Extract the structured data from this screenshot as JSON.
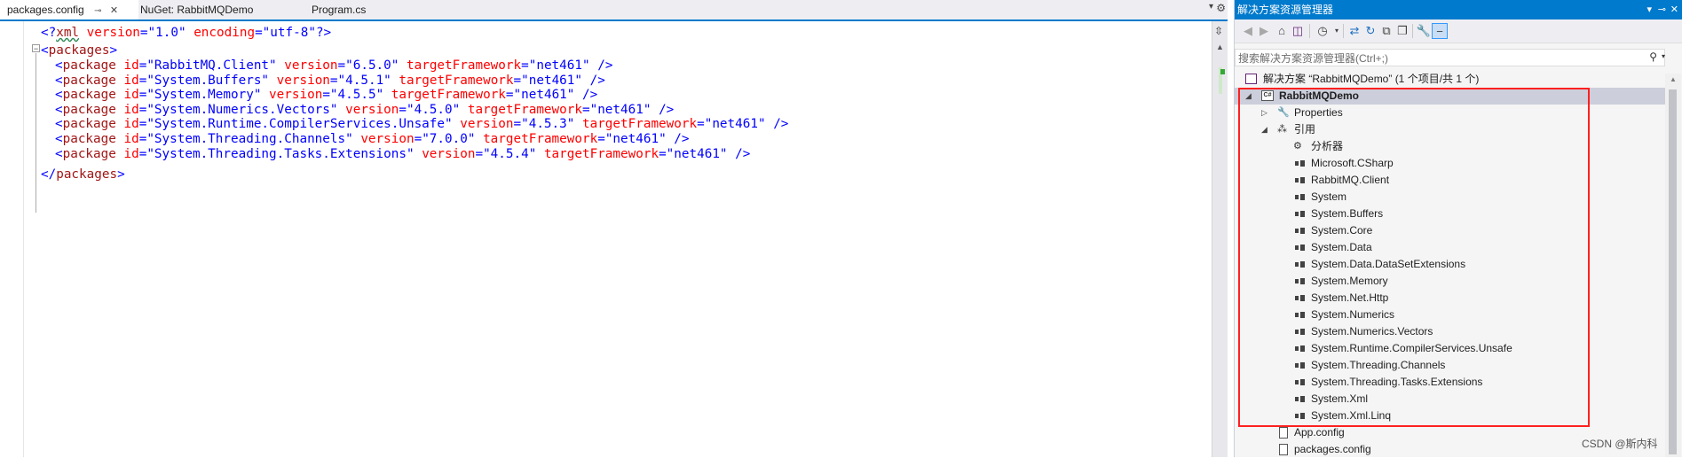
{
  "tabs": [
    {
      "label": "packages.config",
      "pin": "⊸",
      "close": "✕"
    },
    {
      "label": "NuGet: RabbitMQDemo"
    },
    {
      "label": "Program.cs"
    }
  ],
  "tab_dropdown_icon": "chevron-down-icon",
  "tab_settings_icon": "gear-icon",
  "editor": {
    "declaration": {
      "open": "<?",
      "name": "xml",
      "attr1": "version",
      "eq": "=",
      "val1": "\"1.0\"",
      "attr2": "encoding",
      "val2": "\"utf-8\"",
      "close": "?>"
    },
    "root_open": {
      "lt": "<",
      "name": "packages",
      "gt": ">"
    },
    "packages": [
      {
        "id": "\"RabbitMQ.Client\"",
        "version": "\"6.5.0\"",
        "targetFramework": "\"net461\""
      },
      {
        "id": "\"System.Buffers\"",
        "version": "\"4.5.1\"",
        "targetFramework": "\"net461\""
      },
      {
        "id": "\"System.Memory\"",
        "version": "\"4.5.5\"",
        "targetFramework": "\"net461\""
      },
      {
        "id": "\"System.Numerics.Vectors\"",
        "version": "\"4.5.0\"",
        "targetFramework": "\"net461\""
      },
      {
        "id": "\"System.Runtime.CompilerServices.Unsafe\"",
        "version": "\"4.5.3\"",
        "targetFramework": "\"net461\""
      },
      {
        "id": "\"System.Threading.Channels\"",
        "version": "\"7.0.0\"",
        "targetFramework": "\"net461\""
      },
      {
        "id": "\"System.Threading.Tasks.Extensions\"",
        "version": "\"4.5.4\"",
        "targetFramework": "\"net461\""
      }
    ],
    "package_tag": "package",
    "attr_id": "id",
    "attr_version": "version",
    "attr_tf": "targetFramework",
    "self_close": "/>",
    "root_close": {
      "lt": "</",
      "name": "packages",
      "gt": ">"
    },
    "colors": {
      "markup": "#0000ff",
      "attr": "#ff0000",
      "element": "#a31515"
    }
  },
  "solution_explorer": {
    "title": "解决方案资源管理器",
    "title_controls": [
      "▾",
      "⊸",
      "✕"
    ],
    "toolbar_icons": [
      "back-icon",
      "forward-icon",
      "home-icon",
      "vs-icon",
      "history-icon",
      "sync-icon",
      "refresh-icon",
      "collapse-icon",
      "copy-icon",
      "properties-icon",
      "wrench-icon",
      "pin-minus-icon"
    ],
    "search_placeholder": "搜索解决方案资源管理器(Ctrl+;)",
    "solution_label": "解决方案 “RabbitMQDemo” (1 个项目/共 1 个)",
    "project_label": "RabbitMQDemo",
    "project_badge": "C#",
    "properties_label": "Properties",
    "references_label": "引用",
    "analyzers_label": "分析器",
    "references": [
      "Microsoft.CSharp",
      "RabbitMQ.Client",
      "System",
      "System.Buffers",
      "System.Core",
      "System.Data",
      "System.Data.DataSetExtensions",
      "System.Memory",
      "System.Net.Http",
      "System.Numerics",
      "System.Numerics.Vectors",
      "System.Runtime.CompilerServices.Unsafe",
      "System.Threading.Channels",
      "System.Threading.Tasks.Extensions",
      "System.Xml",
      "System.Xml.Linq"
    ],
    "files": [
      "App.config",
      "packages.config"
    ],
    "highlight_color": "#ff2020"
  },
  "watermark": "CSDN @斯内科"
}
